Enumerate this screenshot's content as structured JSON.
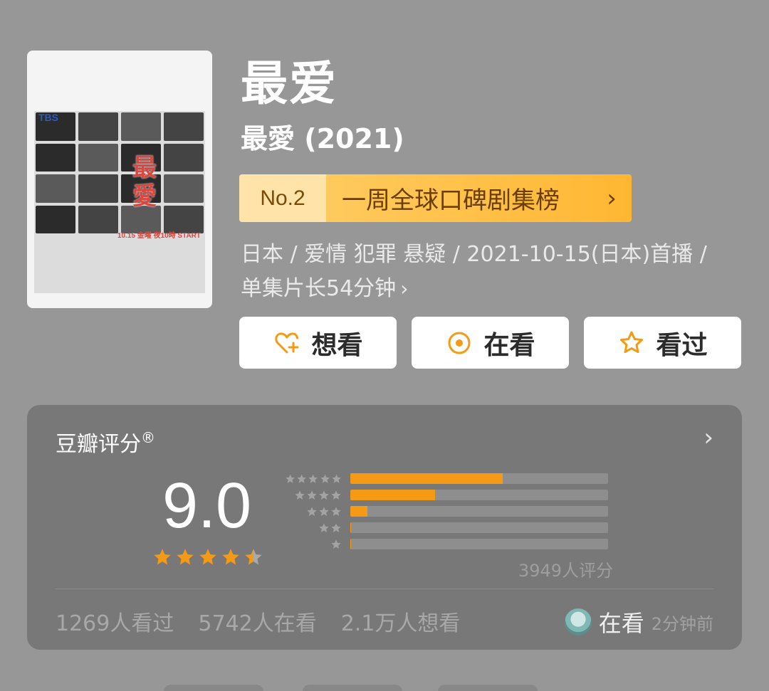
{
  "poster": {
    "network": "TBS",
    "title_chars": [
      "最",
      "愛"
    ],
    "date_text": "10.15 金曜 夜10時 START"
  },
  "title": "最爱",
  "subtitle": "最愛 (2021)",
  "rank": {
    "no": "No.2",
    "label": "一周全球口碑剧集榜",
    "arrow": "›"
  },
  "info": {
    "line1": "日本 / 爱情 犯罪 悬疑 / 2021-10-15(日本)首播 /",
    "line2": "单集片长54分钟",
    "chevron": "›"
  },
  "actions": [
    {
      "label": "想看",
      "icon": "heart-plus-icon"
    },
    {
      "label": "在看",
      "icon": "target-icon"
    },
    {
      "label": "看过",
      "icon": "star-outline-icon"
    }
  ],
  "rating": {
    "title": "豆瓣评分",
    "registered": "®",
    "score": "9.0",
    "stars": 4.5,
    "distribution": [
      {
        "stars": 5,
        "fraction": 0.59
      },
      {
        "stars": 4,
        "fraction": 0.33
      },
      {
        "stars": 3,
        "fraction": 0.065
      },
      {
        "stars": 2,
        "fraction": 0.004
      },
      {
        "stars": 1,
        "fraction": 0.003
      }
    ],
    "count": "3949人评分"
  },
  "stats": {
    "watched": "1269人看过",
    "watching": "5742人在看",
    "wish": "2.1万人想看"
  },
  "friend": {
    "status": "在看",
    "time": "2分钟前"
  },
  "colors": {
    "accent": "#f59a15",
    "rank_bg": "#ffb732",
    "card_bg": "#787878",
    "page_bg": "#979797"
  }
}
